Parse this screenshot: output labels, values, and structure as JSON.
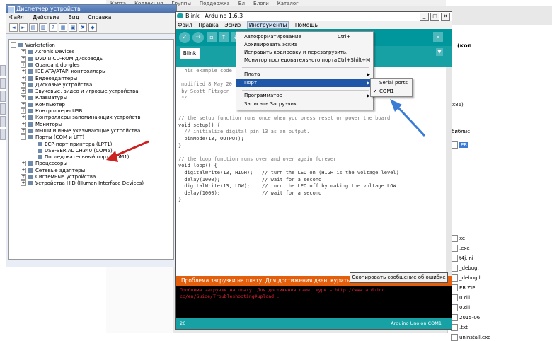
{
  "background": {
    "top_strip": [
      "Карта",
      "Коллекция",
      "Группы",
      "Поддержка",
      "Бл",
      "Блоги",
      "Каталог"
    ],
    "right_panel": {
      "labels": [
        "(кол",
        "x86)",
        "библис"
      ],
      "files": [
        "xe",
        ".exe",
        "t4j.ini",
        "_debug.",
        "_debug.l",
        "ER.ZIP",
        "0.dll",
        "0.dll",
        "2015-06",
        ".txt",
        "uninstall.exe"
      ],
      "selected": "ER"
    }
  },
  "device_manager": {
    "title": "Диспетчер устройств",
    "menu": [
      "Файл",
      "Действие",
      "Вид",
      "Справка"
    ],
    "tree": {
      "root": "Workstation",
      "items": [
        {
          "label": "Acronis Devices",
          "expander": "+"
        },
        {
          "label": "DVD и CD-ROM дисководы",
          "expander": "+"
        },
        {
          "label": "Guardant dongles",
          "expander": "+"
        },
        {
          "label": "IDE ATA/ATAPI контроллеры",
          "expander": "+"
        },
        {
          "label": "Видеоадаптеры",
          "expander": "+"
        },
        {
          "label": "Дисковые устройства",
          "expander": "+"
        },
        {
          "label": "Звуковые, видео и игровые устройства",
          "expander": "+"
        },
        {
          "label": "Клавиатуры",
          "expander": "+"
        },
        {
          "label": "Компьютер",
          "expander": "+"
        },
        {
          "label": "Контроллеры USB",
          "expander": "+"
        },
        {
          "label": "Контроллеры запоминающих устройств",
          "expander": "+"
        },
        {
          "label": "Мониторы",
          "expander": "+"
        },
        {
          "label": "Мыши и иные указывающие устройства",
          "expander": "+"
        },
        {
          "label": "Порты (COM и LPT)",
          "expander": "-"
        }
      ],
      "ports": [
        "ECP-порт принтера (LPT1)",
        "USB-SERIAL CH340 (COM5)",
        "Последовательный порт (COM1)"
      ],
      "items_after": [
        {
          "label": "Процессоры",
          "expander": "+"
        },
        {
          "label": "Сетевые адаптеры",
          "expander": "+"
        },
        {
          "label": "Системные устройства",
          "expander": "+"
        },
        {
          "label": "Устройства HID (Human Interface Devices)",
          "expander": "+"
        }
      ]
    }
  },
  "arduino": {
    "title": "Blink | Arduino 1.6.3",
    "menu": [
      "Файл",
      "Правка",
      "Эскиз",
      "Инструменты",
      "Помощь"
    ],
    "tab": "Blink",
    "code_lines": [
      {
        "text": " This example code",
        "cls": "cm"
      },
      {
        "text": "",
        "cls": ""
      },
      {
        "text": " modified 8 May 20",
        "cls": "cm"
      },
      {
        "text": " by Scott Fitzger",
        "cls": "cm"
      },
      {
        "text": " */",
        "cls": "cm"
      },
      {
        "text": "",
        "cls": ""
      },
      {
        "text": "",
        "cls": ""
      },
      {
        "text": "// the setup function runs once when you press reset or power the board",
        "cls": "cm"
      },
      {
        "text": "void setup() {",
        "cls": ""
      },
      {
        "text": "  // initialize digital pin 13 as an output.",
        "cls": "cm"
      },
      {
        "text": "  pinMode(13, OUTPUT);",
        "cls": ""
      },
      {
        "text": "}",
        "cls": ""
      },
      {
        "text": "",
        "cls": ""
      },
      {
        "text": "// the loop function runs over and over again forever",
        "cls": "cm"
      },
      {
        "text": "void loop() {",
        "cls": ""
      },
      {
        "text": "  digitalWrite(13, HIGH);   // turn the LED on (HIGH is the voltage level)",
        "cls": ""
      },
      {
        "text": "  delay(1000);              // wait for a second",
        "cls": ""
      },
      {
        "text": "  digitalWrite(13, LOW);    // turn the LED off by making the voltage LOW",
        "cls": ""
      },
      {
        "text": "  delay(1000);              // wait for a second",
        "cls": ""
      },
      {
        "text": "}",
        "cls": ""
      }
    ],
    "error_bar": "Проблема загрузки на плату. Для достижения дзен, курить http://ww",
    "console": [
      "Проблема загрузки на плату. Для достижения дзен, курить http://www.arduino.",
      "cc/en/Guide/Troubleshooting#upload ."
    ],
    "status": {
      "line": "26",
      "board": "Arduino Uno on COM1"
    },
    "copy_button": "Скопировать сообщение об ошибке"
  },
  "tools_menu": {
    "items": [
      {
        "label": "Автоформатирование",
        "shortcut": "Ctrl+T"
      },
      {
        "label": "Архивировать эскиз",
        "shortcut": ""
      },
      {
        "label": "Исправить кодировку и перезагрузить.",
        "shortcut": ""
      },
      {
        "label": "Монитор последовательного порта",
        "shortcut": "Ctrl+Shift+M"
      }
    ],
    "board": "Плата",
    "port": "Порт",
    "programmer": "Программатор",
    "bootloader": "Записать Загрузчик"
  },
  "port_submenu": {
    "header": "Serial ports",
    "option": "COM1",
    "check": "✔"
  },
  "colors": {
    "arduino_teal": "#17a1a5",
    "error_orange": "#e35f0b",
    "highlight": "#1e56a8",
    "arrow": "#cc2222",
    "arrow_blue": "#3a7bd5"
  }
}
